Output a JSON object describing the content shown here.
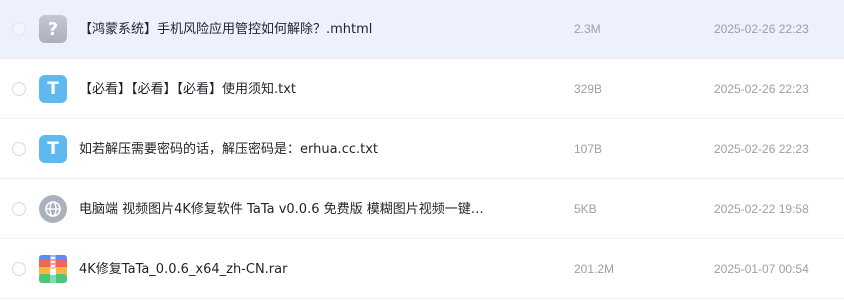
{
  "files": [
    {
      "name": "【鸿蒙系统】手机风险应用管控如何解除？.mhtml",
      "size": "2.3M",
      "date": "2025-02-26 22:23",
      "icon": "unknown-file-icon",
      "icon_glyph": "?",
      "selected": true
    },
    {
      "name": "【必看】【必看】【必看】使用须知.txt",
      "size": "329B",
      "date": "2025-02-26 22:23",
      "icon": "text-file-icon",
      "icon_glyph": "T"
    },
    {
      "name": "如若解压需要密码的话，解压密码是：erhua.cc.txt",
      "size": "107B",
      "date": "2025-02-26 22:23",
      "icon": "text-file-icon",
      "icon_glyph": "T"
    },
    {
      "name": "电脑端 视频图片4K修复软件 TaTa v0.0.6 免费版 模糊图片视频一键…",
      "size": "5KB",
      "date": "2025-02-22 19:58",
      "icon": "web-link-icon"
    },
    {
      "name": "4K修复TaTa_0.0.6_x64_zh-CN.rar",
      "size": "201.2M",
      "date": "2025-01-07 00:54",
      "icon": "archive-file-icon"
    }
  ],
  "colors": {
    "selected_row": "#ecf1fd",
    "text_icon": "#5fb8f0",
    "meta_text": "#9aa0aa"
  }
}
